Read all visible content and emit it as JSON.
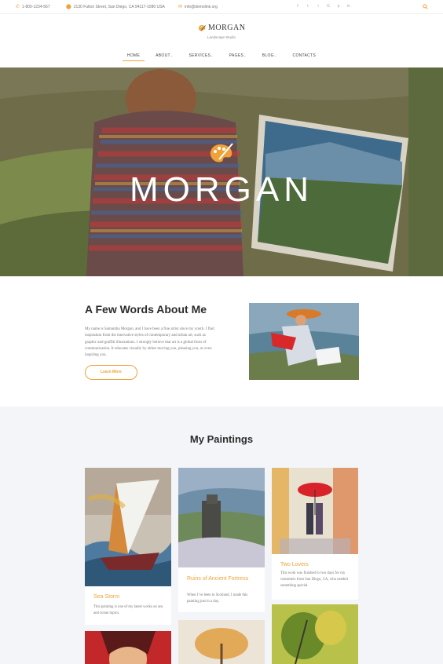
{
  "topbar": {
    "phone": "1-800-1234-567",
    "address": "2130 Fulton Street, San Diego, CA 94117-1080 USA",
    "email": "info@demolink.org",
    "social": [
      "f",
      "t",
      "i",
      "G",
      "p",
      "in"
    ]
  },
  "header": {
    "logo": "MORGAN",
    "tagline": "Landscape Studio"
  },
  "nav": {
    "items": [
      {
        "label": "HOME",
        "caret": ""
      },
      {
        "label": "ABOUT",
        "caret": "⌄"
      },
      {
        "label": "SERVICES",
        "caret": "⌄"
      },
      {
        "label": "PAGES",
        "caret": "⌄"
      },
      {
        "label": "BLOG",
        "caret": "⌄"
      },
      {
        "label": "CONTACTS",
        "caret": ""
      }
    ]
  },
  "hero": {
    "title": "MORGAN"
  },
  "about": {
    "title": "A Few Words About Me",
    "text": "My name is Samantha Morgan, and I have been a fine artist since my youth. I find inspiration from the innovative styles of contemporary and urban art, such as graphic and graffiti illustrations. I strongly believe that art is a global form of communication. It educates visually by either moving you, pleasing you, or even inspiring you.",
    "button": "Learn More"
  },
  "paintings": {
    "title": "My Paintings",
    "cards": [
      {
        "title": "Sea Storm",
        "desc": "This painting is one of my latest works on sea and ocean topics."
      },
      {
        "title": "Ruins of Ancient Fortress",
        "desc": "When I’ve been to Scotland, I made this painting just in a day."
      },
      {
        "title": "Two Lovers",
        "desc": "This work was finished in two days for my customers from San Diego, CA, who needed something special."
      }
    ]
  },
  "colors": {
    "accent": "#f0a23a",
    "section_bg": "#f4f5f8"
  }
}
